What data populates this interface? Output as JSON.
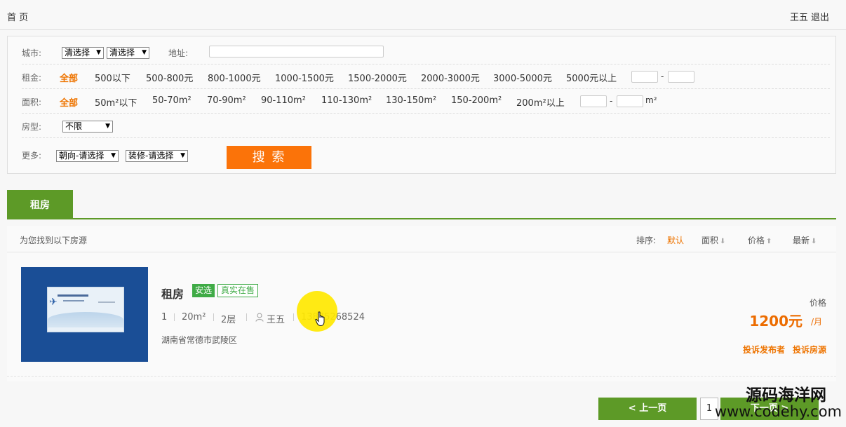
{
  "topbar": {
    "home": "首 页",
    "user_name": "王五",
    "logout": "退出"
  },
  "filter": {
    "city": {
      "label": "城市:",
      "province": "清选择",
      "city": "清选择",
      "address_label": "地址:",
      "address_value": ""
    },
    "rent": {
      "label": "租金:",
      "options": [
        "全部",
        "500以下",
        "500-800元",
        "800-1000元",
        "1000-1500元",
        "1500-2000元",
        "2000-3000元",
        "3000-5000元",
        "5000元以上"
      ],
      "active": "全部",
      "range_sep": "-"
    },
    "area": {
      "label": "面积:",
      "options": [
        "全部",
        "50m²以下",
        "50-70m²",
        "70-90m²",
        "90-110m²",
        "110-130m²",
        "130-150m²",
        "150-200m²",
        "200m²以上"
      ],
      "active": "全部",
      "range_sep": "-",
      "unit": "m²"
    },
    "room": {
      "label": "房型:",
      "value": "不限"
    },
    "more": {
      "label": "更多:",
      "orientation": "朝向-请选择",
      "decoration": "装修-请选择"
    },
    "search_button": "搜 索"
  },
  "tabs": [
    {
      "label": "租房",
      "active": true
    }
  ],
  "results": {
    "title": "为您找到以下房源",
    "sort": {
      "label": "排序:",
      "options": [
        "默认",
        "面积",
        "价格",
        "最新"
      ],
      "active": "默认"
    },
    "items": [
      {
        "title": "租房",
        "badges": [
          "安选",
          "真实在售"
        ],
        "rooms": "1",
        "area": "20m²",
        "floor": "2层",
        "agent": "王五",
        "phone": "13875268524",
        "address": "湖南省常德市武陵区",
        "price_label": "价格",
        "price": "1200元",
        "price_unit": "/月",
        "actions": [
          "投诉发布者",
          "投诉房源"
        ]
      }
    ]
  },
  "pager": {
    "prev": "< 上一页",
    "page": "1",
    "next": "下一页 >"
  },
  "watermark": {
    "line1": "源码海洋网",
    "line2": "www.codehy.com"
  },
  "colors": {
    "accent_orange": "#ee7400",
    "brand_green": "#5d9a27",
    "search_orange": "#fb7309"
  }
}
